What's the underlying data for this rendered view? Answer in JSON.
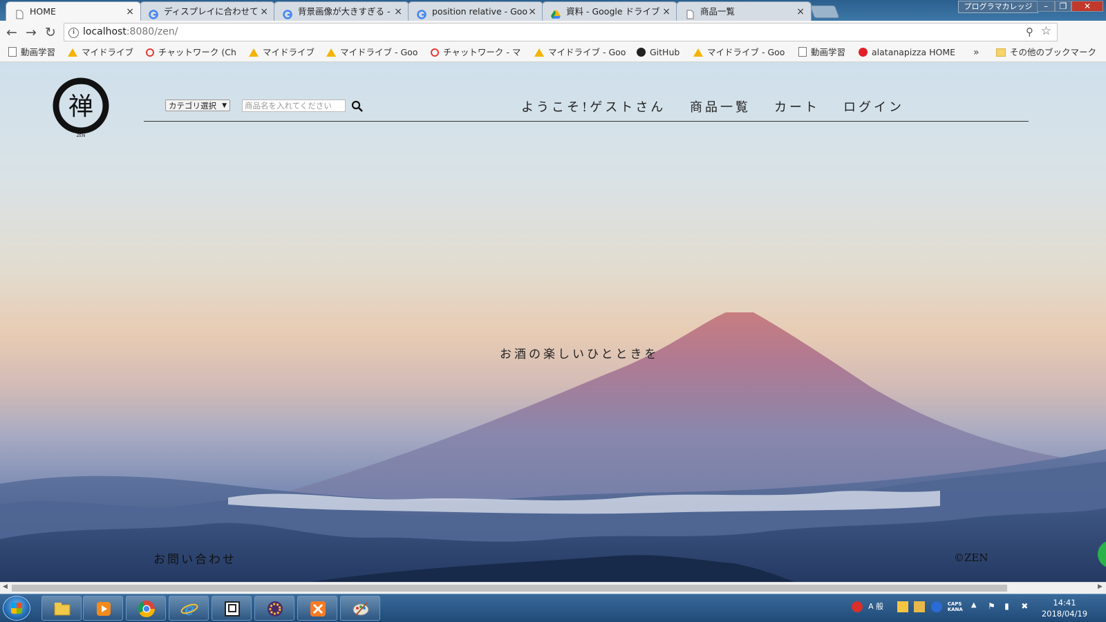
{
  "browser": {
    "tabs": [
      {
        "title": "HOME",
        "icon": "page-icon",
        "active": true
      },
      {
        "title": "ディスプレイに合わせて",
        "icon": "google-icon"
      },
      {
        "title": "背景画像が大きすぎる -",
        "icon": "google-icon"
      },
      {
        "title": "position relative - Goo",
        "icon": "google-icon"
      },
      {
        "title": "資料 - Google ドライブ",
        "icon": "drive-icon"
      },
      {
        "title": "商品一覧",
        "icon": "page-icon"
      }
    ],
    "close_glyph": "×",
    "profile_label": "プログラマカレッジ",
    "window_controls": {
      "minimize": "–",
      "maximize": "❐",
      "close": "✕"
    },
    "nav": {
      "back": "←",
      "forward": "→",
      "reload": "↻"
    },
    "address": {
      "host": "localhost",
      "rest": ":8080/zen/"
    },
    "bookmarks": [
      {
        "label": "動画学習",
        "icon": "page-icon"
      },
      {
        "label": "マイドライブ",
        "icon": "drive-icon"
      },
      {
        "label": "チャットワーク (Ch",
        "icon": "chatwork-icon"
      },
      {
        "label": "マイドライブ",
        "icon": "drive-icon"
      },
      {
        "label": "マイドライブ - Goo",
        "icon": "drive-icon"
      },
      {
        "label": "チャットワーク - マ",
        "icon": "chatwork-icon"
      },
      {
        "label": "マイドライブ - Goo",
        "icon": "drive-icon"
      },
      {
        "label": "GitHub",
        "icon": "github-icon"
      },
      {
        "label": "マイドライブ - Goo",
        "icon": "drive-icon"
      },
      {
        "label": "動画学習",
        "icon": "page-icon"
      },
      {
        "label": "alatanapizza HOME",
        "icon": "pizza-icon"
      }
    ],
    "bookmarks_overflow": "»",
    "other_bookmarks": "その他のブックマーク"
  },
  "site": {
    "logo_char": "禅",
    "logo_sub": "ZEN",
    "category_select": "カテゴリ選択",
    "search_placeholder": "商品名を入れてください",
    "nav": {
      "welcome": "ようこそ!ゲストさん",
      "products": "商品一覧",
      "cart": "カート",
      "login": "ログイン"
    },
    "tagline": "お酒の楽しいひとときを",
    "footer": {
      "contact": "お問い合わせ",
      "copyright": "©ZEN"
    }
  },
  "taskbar": {
    "apps": [
      "explorer-icon",
      "media-player-icon",
      "chrome-icon",
      "ie-icon",
      "terminal-icon",
      "javaee-ide-icon",
      "xampp-icon",
      "paint-icon"
    ],
    "clock_time": "14:41",
    "clock_date": "2018/04/19",
    "ime": "A 般",
    "caps": "CAPS",
    "kana": "KANA"
  },
  "colors": {
    "browser_accent": "#3d78a8",
    "mountain_peak": "#c07a80",
    "text_dark": "#222222"
  }
}
